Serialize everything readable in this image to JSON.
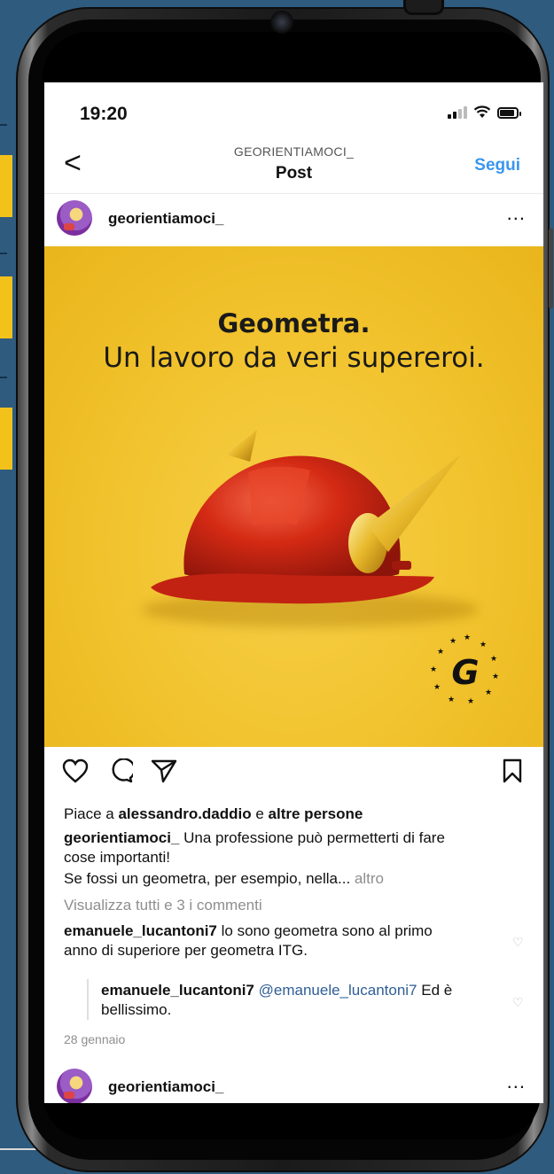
{
  "status_bar": {
    "time": "19:20"
  },
  "header": {
    "back_icon": "chevron-left-icon",
    "back_glyph": "<",
    "username_caption": "GEORIENTIAMOCI_",
    "title": "Post",
    "follow_label": "Segui"
  },
  "post": {
    "username": "georientiamoci_",
    "more_glyph": "...",
    "image": {
      "headline": "Geometra.",
      "subheadline": "Un lavoro da veri supereroi."
    },
    "likes_prefix": "Piace a ",
    "likes_user": "alessandro.daddio",
    "likes_mid": " e ",
    "likes_suffix": "altre persone",
    "caption_user": "georientiamoci_",
    "caption_line1": " Una professione può permetterti di fare",
    "caption_line2": "cose importanti!",
    "caption_line3": "Se fossi un geometra, per esempio, nella...",
    "more_label": "altro",
    "view_comments": "Visualizza tutti e 3 i commenti",
    "comments": [
      {
        "user": "emanuele_lucantoni7",
        "text_line1": " lo sono geometra sono al primo",
        "text_line2": "anno di superiore per geometra ITG."
      }
    ],
    "reply": {
      "user": "emanuele_lucantoni7",
      "mention": "@emanuele_lucantoni7",
      "text_line1": " Ed è",
      "text_line2": "bellissimo."
    },
    "date": "28 gennaio"
  },
  "next_post": {
    "username": "georientiamoci_",
    "more_glyph": "..."
  },
  "colors": {
    "accent_blue": "#3a96ee",
    "post_yellow": "#f1c22c",
    "helmet_red": "#d42a14"
  }
}
